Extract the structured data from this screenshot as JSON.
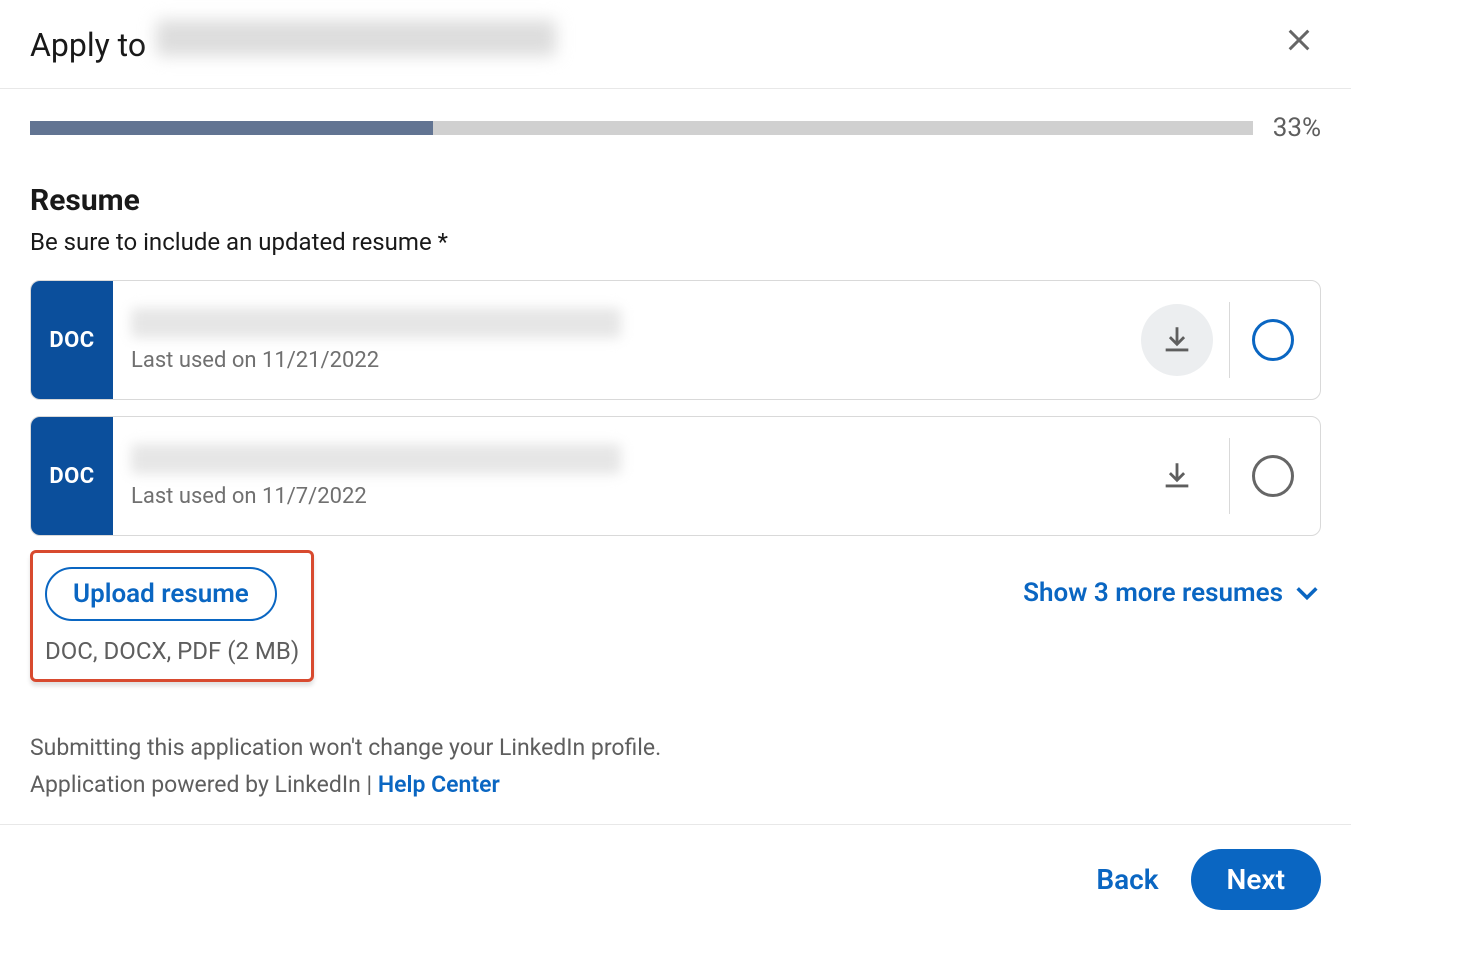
{
  "header": {
    "title_prefix": "Apply to",
    "company_redacted": true
  },
  "progress": {
    "percent": 33,
    "percent_label": "33%"
  },
  "resume": {
    "title": "Resume",
    "subtitle": "Be sure to include an updated resume *",
    "items": [
      {
        "type_label": "DOC",
        "name_redacted": true,
        "meta": "Last used on 11/21/2022",
        "download_hover": true,
        "selected_style": "active"
      },
      {
        "type_label": "DOC",
        "name_redacted": true,
        "meta": "Last used on 11/7/2022",
        "download_hover": false,
        "selected_style": ""
      }
    ],
    "upload": {
      "button": "Upload resume",
      "hint": "DOC, DOCX, PDF (2 MB)"
    },
    "show_more": "Show 3 more resumes"
  },
  "footer": {
    "note": "Submitting this application won't change your LinkedIn profile.",
    "powered_prefix": "Application powered by LinkedIn | ",
    "help_link": "Help Center"
  },
  "actions": {
    "back": "Back",
    "next": "Next"
  }
}
